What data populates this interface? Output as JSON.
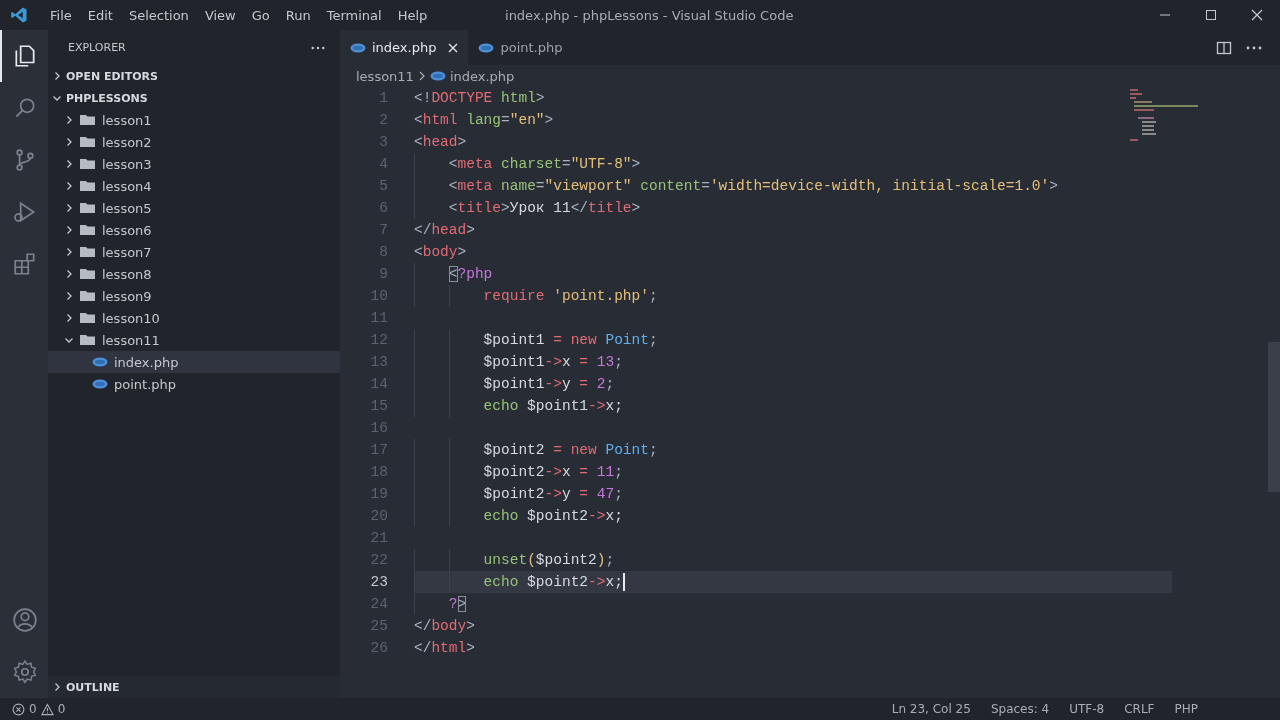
{
  "title_bar": {
    "menu": [
      "File",
      "Edit",
      "Selection",
      "View",
      "Go",
      "Run",
      "Terminal",
      "Help"
    ],
    "title": "index.php - phpLessons - Visual Studio Code"
  },
  "activity_bar": {
    "top": [
      {
        "kind": "files",
        "selected": true
      },
      {
        "kind": "search",
        "selected": false
      },
      {
        "kind": "source-control",
        "selected": false
      },
      {
        "kind": "run",
        "selected": false
      },
      {
        "kind": "extensions",
        "selected": false
      }
    ],
    "bottom": [
      {
        "kind": "account",
        "selected": false
      },
      {
        "kind": "settings",
        "selected": false
      }
    ]
  },
  "sidebar": {
    "title": "EXPLORER",
    "sections": [
      {
        "label": "OPEN EDITORS",
        "expanded": false
      },
      {
        "label": "PHPLESSONS",
        "expanded": true,
        "items": [
          {
            "label": "lesson1",
            "kind": "folder",
            "expanded": false,
            "selected": false
          },
          {
            "label": "lesson2",
            "kind": "folder",
            "expanded": false,
            "selected": false
          },
          {
            "label": "lesson3",
            "kind": "folder",
            "expanded": false,
            "selected": false
          },
          {
            "label": "lesson4",
            "kind": "folder",
            "expanded": false,
            "selected": false
          },
          {
            "label": "lesson5",
            "kind": "folder",
            "expanded": false,
            "selected": false
          },
          {
            "label": "lesson6",
            "kind": "folder",
            "expanded": false,
            "selected": false
          },
          {
            "label": "lesson7",
            "kind": "folder",
            "expanded": false,
            "selected": false
          },
          {
            "label": "lesson8",
            "kind": "folder",
            "expanded": false,
            "selected": false
          },
          {
            "label": "lesson9",
            "kind": "folder",
            "expanded": false,
            "selected": false
          },
          {
            "label": "lesson10",
            "kind": "folder",
            "expanded": false,
            "selected": false
          },
          {
            "label": "lesson11",
            "kind": "folder",
            "expanded": true,
            "selected": false,
            "children": [
              {
                "label": "index.php",
                "kind": "php",
                "selected": true
              },
              {
                "label": "point.php",
                "kind": "php",
                "selected": false
              }
            ]
          }
        ]
      }
    ],
    "bottom_sections": [
      {
        "label": "OUTLINE",
        "expanded": false
      }
    ]
  },
  "tabs": [
    {
      "label": "index.php",
      "selected": true
    },
    {
      "label": "point.php",
      "selected": false
    }
  ],
  "breadcrumb": [
    {
      "label": "lesson11",
      "kind": "folder"
    },
    {
      "label": "index.php",
      "kind": "php"
    }
  ],
  "editor": {
    "lines": [
      {
        "number": "1",
        "current": false,
        "tokens": [
          {
            "kind": "punct",
            "text": "<!"
          },
          {
            "kind": "tag",
            "text": "DOCTYPE"
          },
          {
            "kind": "attr",
            "text": " html"
          },
          {
            "kind": "punct",
            "text": ">"
          }
        ]
      },
      {
        "number": "2",
        "current": false,
        "tokens": [
          {
            "kind": "punct",
            "text": "<"
          },
          {
            "kind": "tag",
            "text": "html"
          },
          {
            "kind": "attr",
            "text": " lang"
          },
          {
            "kind": "punct",
            "text": "="
          },
          {
            "kind": "string",
            "text": "\"en\""
          },
          {
            "kind": "punct",
            "text": ">"
          }
        ]
      },
      {
        "number": "3",
        "current": false,
        "tokens": [
          {
            "kind": "punct",
            "text": "<"
          },
          {
            "kind": "tag",
            "text": "head"
          },
          {
            "kind": "punct",
            "text": ">"
          }
        ]
      },
      {
        "number": "4",
        "current": false,
        "tokens": [
          {
            "kind": "punct",
            "text": "    <"
          },
          {
            "kind": "tag",
            "text": "meta"
          },
          {
            "kind": "attr",
            "text": " charset"
          },
          {
            "kind": "punct",
            "text": "="
          },
          {
            "kind": "string",
            "text": "\"UTF-8\""
          },
          {
            "kind": "punct",
            "text": ">"
          }
        ]
      },
      {
        "number": "5",
        "current": false,
        "tokens": [
          {
            "kind": "punct",
            "text": "    <"
          },
          {
            "kind": "tag",
            "text": "meta"
          },
          {
            "kind": "attr",
            "text": " name"
          },
          {
            "kind": "punct",
            "text": "="
          },
          {
            "kind": "string",
            "text": "\"viewport\""
          },
          {
            "kind": "attr",
            "text": " content"
          },
          {
            "kind": "punct",
            "text": "="
          },
          {
            "kind": "string",
            "text": "'width=device-width, initial-scale=1.0'"
          },
          {
            "kind": "punct",
            "text": ">"
          }
        ]
      },
      {
        "number": "6",
        "current": false,
        "tokens": [
          {
            "kind": "punct",
            "text": "    <"
          },
          {
            "kind": "tag",
            "text": "title"
          },
          {
            "kind": "punct",
            "text": ">"
          },
          {
            "kind": "text",
            "text": "Урок 11"
          },
          {
            "kind": "punct",
            "text": "</"
          },
          {
            "kind": "tag",
            "text": "title"
          },
          {
            "kind": "punct",
            "text": ">"
          }
        ]
      },
      {
        "number": "7",
        "current": false,
        "tokens": [
          {
            "kind": "punct",
            "text": "</"
          },
          {
            "kind": "tag",
            "text": "head"
          },
          {
            "kind": "punct",
            "text": ">"
          }
        ]
      },
      {
        "number": "8",
        "current": false,
        "tokens": [
          {
            "kind": "punct",
            "text": "<"
          },
          {
            "kind": "tag",
            "text": "body"
          },
          {
            "kind": "punct",
            "text": ">"
          }
        ]
      },
      {
        "number": "9",
        "current": false,
        "tokens": [
          {
            "kind": "match",
            "text": "    <"
          },
          {
            "kind": "php",
            "text": "?php"
          }
        ]
      },
      {
        "number": "10",
        "current": false,
        "tokens": [
          {
            "kind": "keyword",
            "text": "        require"
          },
          {
            "kind": "string",
            "text": " 'point.php'"
          },
          {
            "kind": "punct",
            "text": ";"
          }
        ]
      },
      {
        "number": "11",
        "current": false
      },
      {
        "number": "12",
        "current": false,
        "tokens": [
          {
            "kind": "variable",
            "text": "        $point1"
          },
          {
            "kind": "operator",
            "text": " = "
          },
          {
            "kind": "keyword",
            "text": "new"
          },
          {
            "kind": "class",
            "text": " Point"
          },
          {
            "kind": "punct",
            "text": ";"
          }
        ]
      },
      {
        "number": "13",
        "current": false,
        "tokens": [
          {
            "kind": "variable",
            "text": "        $point1"
          },
          {
            "kind": "operator",
            "text": "->"
          },
          {
            "kind": "variable",
            "text": "x"
          },
          {
            "kind": "operator",
            "text": " = "
          },
          {
            "kind": "number",
            "text": "13"
          },
          {
            "kind": "punct",
            "text": ";"
          }
        ]
      },
      {
        "number": "14",
        "current": false,
        "tokens": [
          {
            "kind": "variable",
            "text": "        $point1"
          },
          {
            "kind": "operator",
            "text": "->"
          },
          {
            "kind": "variable",
            "text": "y"
          },
          {
            "kind": "operator",
            "text": " = "
          },
          {
            "kind": "number",
            "text": "2"
          },
          {
            "kind": "punct",
            "text": ";"
          }
        ]
      },
      {
        "number": "15",
        "current": false,
        "tokens": [
          {
            "kind": "function",
            "text": "        echo"
          },
          {
            "kind": "variable",
            "text": " $point1"
          },
          {
            "kind": "operator",
            "text": "->"
          },
          {
            "kind": "variable",
            "text": "x;"
          }
        ]
      },
      {
        "number": "16",
        "current": false
      },
      {
        "number": "17",
        "current": false,
        "tokens": [
          {
            "kind": "variable",
            "text": "        $point2"
          },
          {
            "kind": "operator",
            "text": " = "
          },
          {
            "kind": "keyword",
            "text": "new"
          },
          {
            "kind": "class",
            "text": " Point"
          },
          {
            "kind": "punct",
            "text": ";"
          }
        ]
      },
      {
        "number": "18",
        "current": false,
        "tokens": [
          {
            "kind": "variable",
            "text": "        $point2"
          },
          {
            "kind": "operator",
            "text": "->"
          },
          {
            "kind": "variable",
            "text": "x"
          },
          {
            "kind": "operator",
            "text": " = "
          },
          {
            "kind": "number",
            "text": "11"
          },
          {
            "kind": "punct",
            "text": ";"
          }
        ]
      },
      {
        "number": "19",
        "current": false,
        "tokens": [
          {
            "kind": "variable",
            "text": "        $point2"
          },
          {
            "kind": "operator",
            "text": "->"
          },
          {
            "kind": "variable",
            "text": "y"
          },
          {
            "kind": "operator",
            "text": " = "
          },
          {
            "kind": "number",
            "text": "47"
          },
          {
            "kind": "punct",
            "text": ";"
          }
        ]
      },
      {
        "number": "20",
        "current": false,
        "tokens": [
          {
            "kind": "function",
            "text": "        echo"
          },
          {
            "kind": "variable",
            "text": " $point2"
          },
          {
            "kind": "operator",
            "text": "->"
          },
          {
            "kind": "variable",
            "text": "x;"
          }
        ]
      },
      {
        "number": "21",
        "current": false
      },
      {
        "number": "22",
        "current": false,
        "tokens": [
          {
            "kind": "function",
            "text": "        unset"
          },
          {
            "kind": "bracket",
            "text": "("
          },
          {
            "kind": "variable",
            "text": "$point2"
          },
          {
            "kind": "bracket",
            "text": ")"
          },
          {
            "kind": "punct",
            "text": ";"
          }
        ]
      },
      {
        "number": "23",
        "current": true,
        "tokens": [
          {
            "kind": "function",
            "text": "        echo"
          },
          {
            "kind": "variable",
            "text": " $point2"
          },
          {
            "kind": "operator",
            "text": "->"
          },
          {
            "kind": "variable",
            "text": "x;"
          }
        ]
      },
      {
        "number": "24",
        "current": false,
        "tokens": [
          {
            "kind": "php",
            "text": "    ?"
          },
          {
            "kind": "match",
            "text": ">"
          }
        ]
      },
      {
        "number": "25",
        "current": false,
        "tokens": [
          {
            "kind": "punct",
            "text": "</"
          },
          {
            "kind": "tag",
            "text": "body"
          },
          {
            "kind": "punct",
            "text": ">"
          }
        ]
      },
      {
        "number": "26",
        "current": false,
        "tokens": [
          {
            "kind": "punct",
            "text": "</"
          },
          {
            "kind": "tag",
            "text": "html"
          },
          {
            "kind": "punct",
            "text": ">"
          }
        ]
      }
    ]
  },
  "status_bar": {
    "errors": "0",
    "warnings": "0",
    "items": [
      "Ln 23, Col 25",
      "Spaces: 4",
      "UTF-8",
      "CRLF",
      "PHP"
    ]
  }
}
